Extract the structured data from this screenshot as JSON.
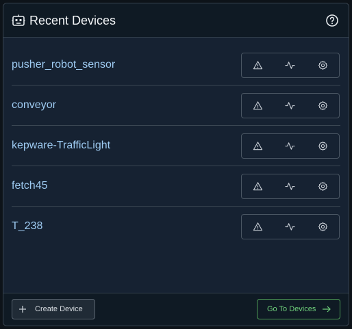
{
  "header": {
    "title": "Recent Devices",
    "icon": "robot-icon",
    "help_icon": "help-circle-icon"
  },
  "devices": [
    {
      "name": "pusher_robot_sensor"
    },
    {
      "name": "conveyor"
    },
    {
      "name": "kepware-TrafficLight"
    },
    {
      "name": "fetch45"
    },
    {
      "name": "T_238"
    }
  ],
  "row_actions": {
    "icons": [
      "alert-triangle-icon",
      "activity-icon",
      "settings-gear-icon"
    ]
  },
  "footer": {
    "create_label": "Create Device",
    "goto_label": "Go To Devices"
  },
  "colors": {
    "background": "#162232",
    "header_bg": "#0f1a24",
    "device_name": "#9ecbf2",
    "accent_green": "#4d9a55",
    "icon_color": "#c9cfd6"
  }
}
